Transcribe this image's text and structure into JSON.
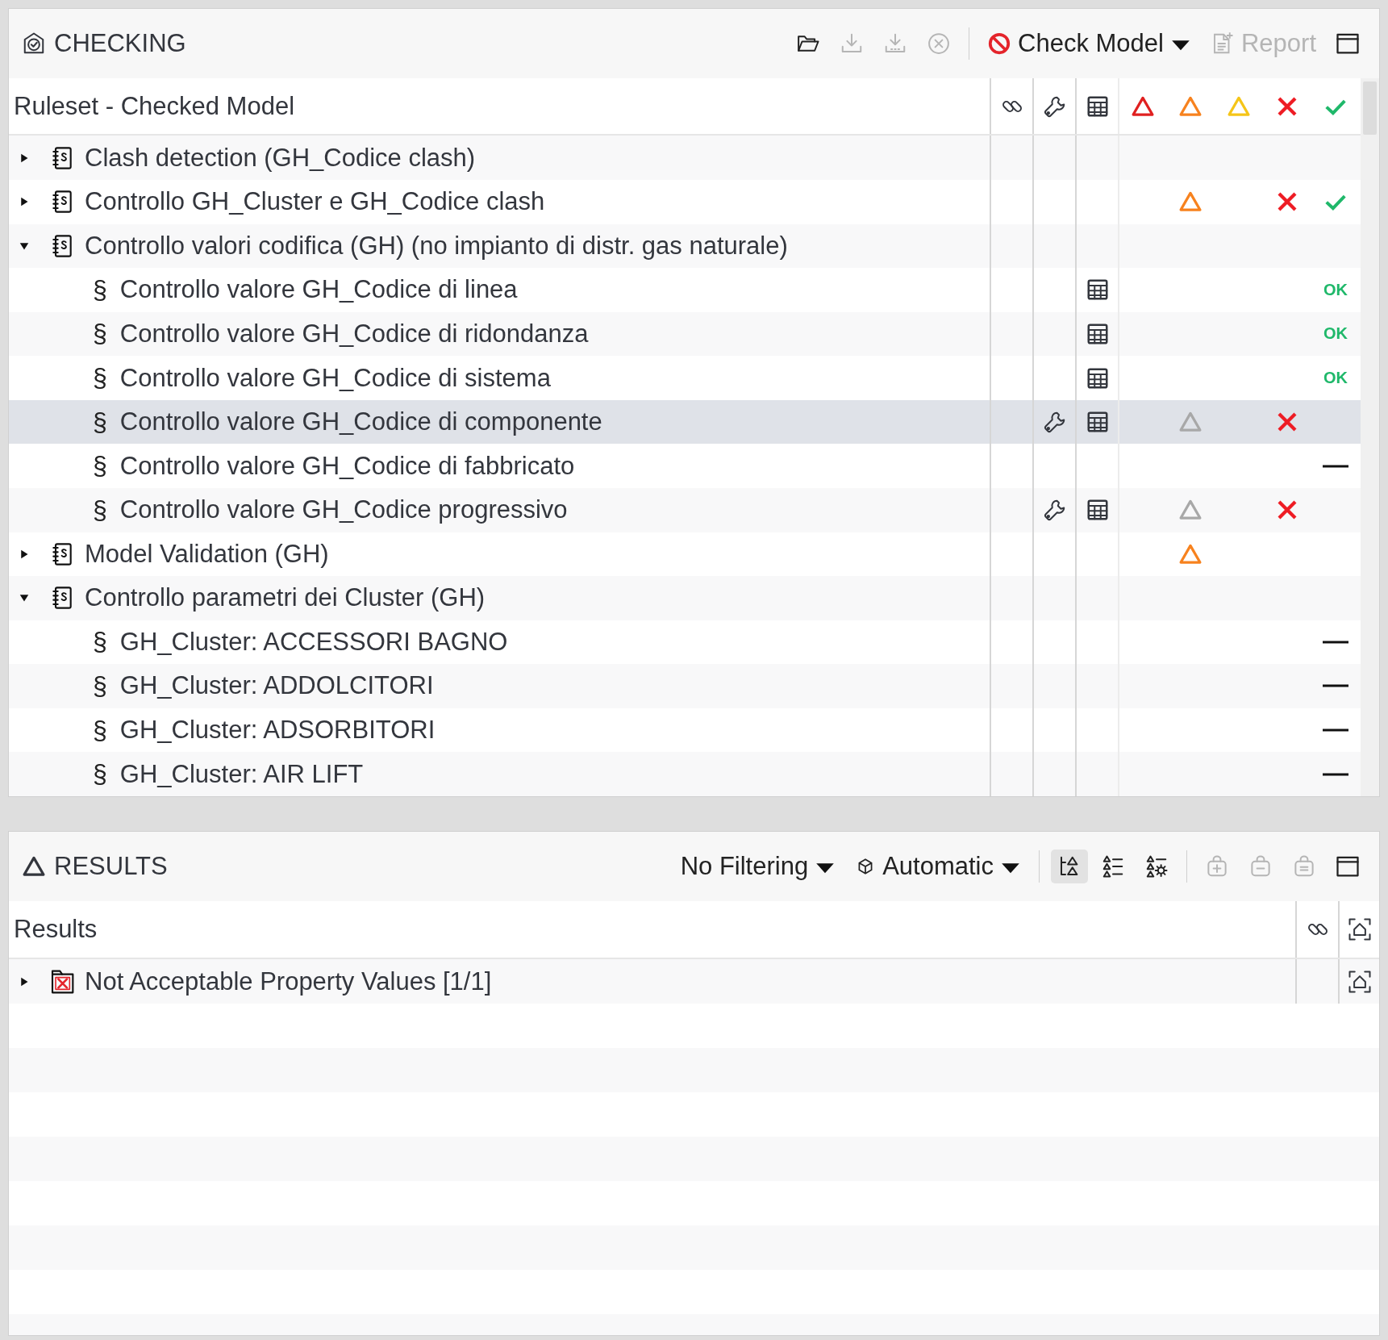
{
  "checking": {
    "title": "CHECKING",
    "toolbar": [
      {
        "kind": "open",
        "disabled": false
      },
      {
        "kind": "download",
        "disabled": true
      },
      {
        "kind": "download-all",
        "disabled": true
      },
      {
        "kind": "cancel",
        "disabled": true
      },
      {
        "kind": "separator"
      },
      {
        "kind": "check-model",
        "label": "Check Model",
        "disabled": false
      },
      {
        "kind": "report",
        "label": "Report",
        "disabled": true
      },
      {
        "kind": "maximize",
        "disabled": false
      }
    ],
    "tree_header": "Ruleset - Checked Model",
    "rows": [
      {
        "label": "Clash detection (GH_Codice clash)",
        "expanded": false,
        "selected": false
      },
      {
        "label": "Controllo GH_Cluster e GH_Codice clash",
        "expanded": false,
        "selected": false,
        "warning": {
          "color": "#f7821e"
        },
        "error": true,
        "result": {
          "kind": "check"
        }
      },
      {
        "label": "Controllo valori codifica (GH) (no impianto di distr. gas naturale)",
        "expanded": true,
        "selected": false,
        "children": [
          {
            "label": "Controllo valore GH_Codice di linea",
            "symbol": "§",
            "selected": false,
            "table": true,
            "result": {
              "kind": "ok",
              "text": "OK"
            }
          },
          {
            "label": "Controllo valore GH_Codice di ridondanza",
            "symbol": "§",
            "selected": false,
            "table": true,
            "result": {
              "kind": "ok",
              "text": "OK"
            }
          },
          {
            "label": "Controllo valore GH_Codice di sistema",
            "symbol": "§",
            "selected": false,
            "table": true,
            "result": {
              "kind": "ok",
              "text": "OK"
            }
          },
          {
            "label": "Controllo valore GH_Codice di componente",
            "symbol": "§",
            "selected": true,
            "wrench": true,
            "table": true,
            "warning": {
              "color": "#a8a8a8"
            },
            "error": true
          },
          {
            "label": "Controllo valore GH_Codice di fabbricato",
            "symbol": "§",
            "selected": false,
            "result": {
              "kind": "dash"
            }
          },
          {
            "label": "Controllo valore GH_Codice progressivo",
            "symbol": "§",
            "selected": false,
            "wrench": true,
            "table": true,
            "warning": {
              "color": "#a8a8a8"
            },
            "error": true
          }
        ]
      },
      {
        "label": "Model Validation (GH)",
        "expanded": false,
        "selected": false,
        "warning": {
          "color": "#f7821e"
        }
      },
      {
        "label": "Controllo parametri dei Cluster (GH)",
        "expanded": true,
        "selected": false,
        "children": [
          {
            "label": "GH_Cluster: ACCESSORI BAGNO",
            "symbol": "§",
            "selected": false,
            "result": {
              "kind": "dash"
            }
          },
          {
            "label": "GH_Cluster: ADDOLCITORI",
            "symbol": "§",
            "selected": false,
            "result": {
              "kind": "dash"
            }
          },
          {
            "label": "GH_Cluster: ADSORBITORI",
            "symbol": "§",
            "selected": false,
            "result": {
              "kind": "dash"
            }
          },
          {
            "label": "GH_Cluster: AIR LIFT",
            "symbol": "§",
            "selected": false,
            "result": {
              "kind": "dash"
            }
          }
        ]
      }
    ]
  },
  "results": {
    "title": "RESULTS",
    "toolbar": [
      {
        "kind": "filter-dropdown",
        "label": "No Filtering",
        "disabled": false
      },
      {
        "kind": "auto-dropdown",
        "label": "Automatic",
        "disabled": false
      },
      {
        "kind": "separator"
      },
      {
        "kind": "tree-view",
        "selected": true,
        "disabled": false
      },
      {
        "kind": "list-view",
        "selected": false,
        "disabled": false
      },
      {
        "kind": "list-settings",
        "selected": false,
        "disabled": false
      },
      {
        "kind": "separator"
      },
      {
        "kind": "add",
        "disabled": true
      },
      {
        "kind": "remove",
        "disabled": true
      },
      {
        "kind": "equal",
        "disabled": true
      },
      {
        "kind": "maximize",
        "disabled": false
      }
    ],
    "header": "Results",
    "rows": [
      {
        "label": "Not Acceptable Property Values [1/1]",
        "expanded": false,
        "selected": false,
        "camera": true
      }
    ]
  }
}
